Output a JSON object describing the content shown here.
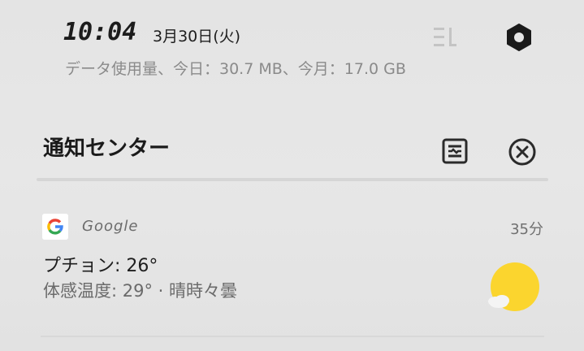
{
  "status": {
    "time": "10:04",
    "date": "3月30日(火)",
    "data_usage": "データ使用量、今日：30.7 MB、今月：17.0 GB"
  },
  "notification_center": {
    "title": "通知センター"
  },
  "notification": {
    "app": "Google",
    "time_ago": "35分",
    "title": "プチョン: 26°",
    "body": "体感温度: 29° · 晴時々曇",
    "icon": "partly-sunny-weather-icon"
  },
  "colors": {
    "sun": "#fbd52e",
    "google_blue": "#4285F4",
    "google_red": "#EA4335",
    "google_yellow": "#FBBC05",
    "google_green": "#34A853"
  }
}
